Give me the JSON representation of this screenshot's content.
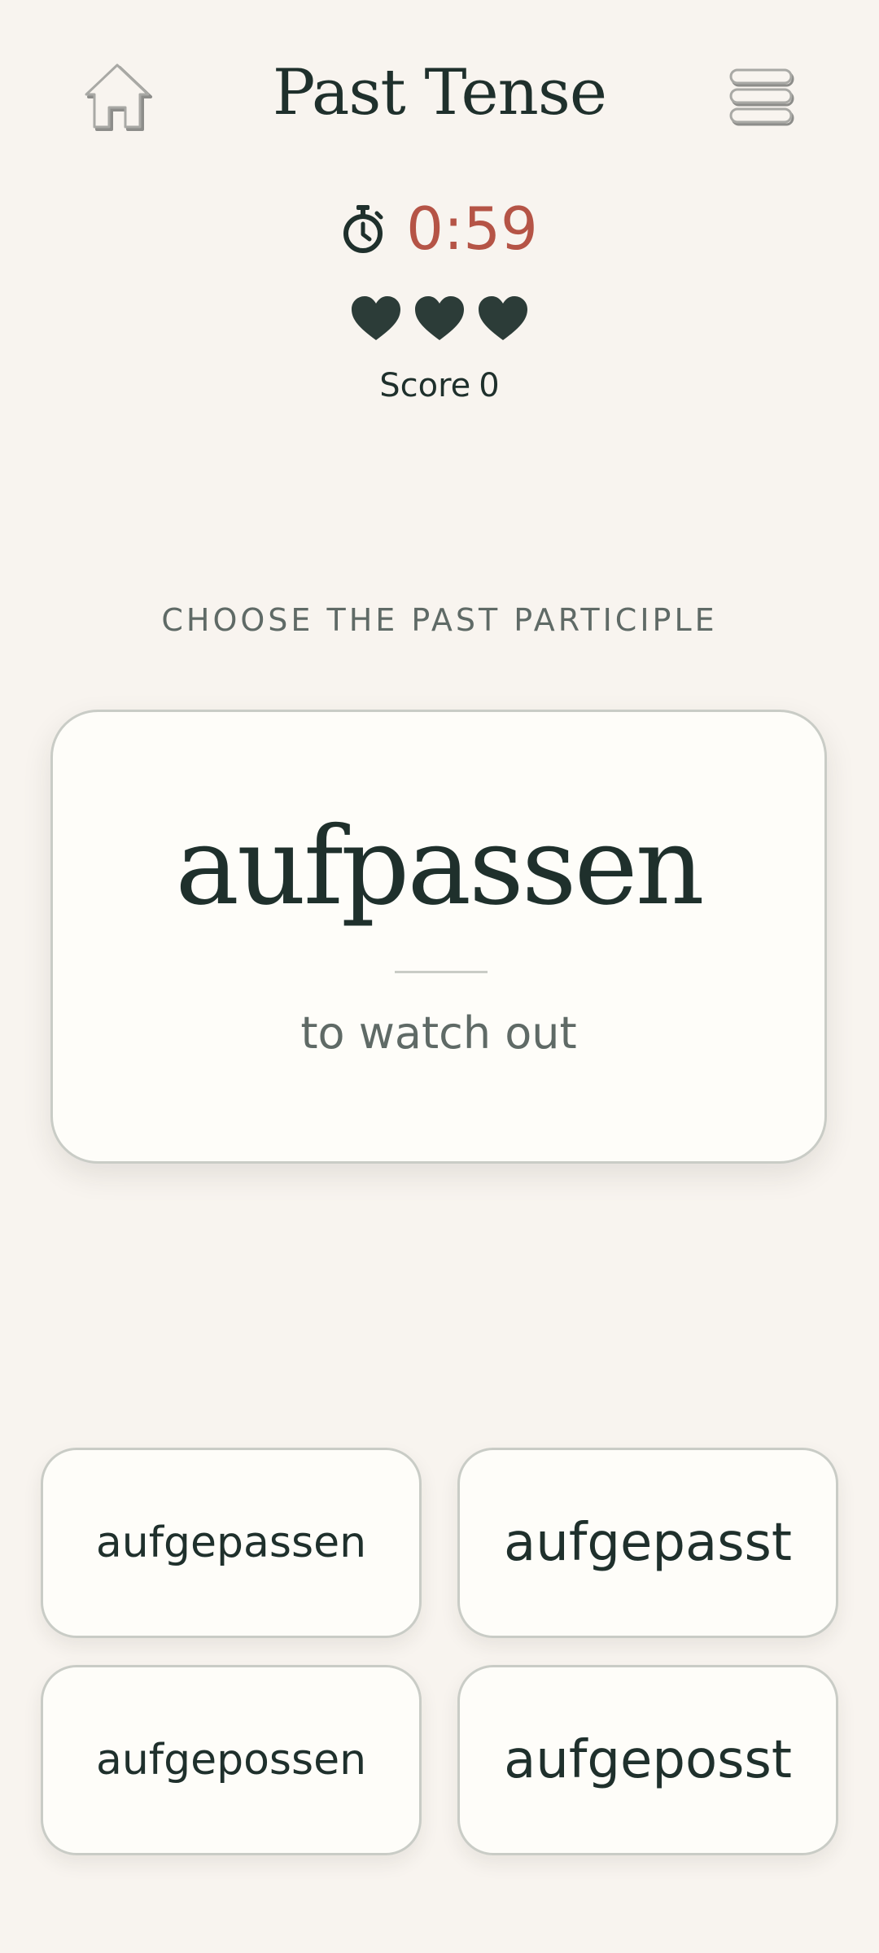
{
  "header": {
    "title": "Past Tense",
    "home_icon": "home-icon",
    "menu_icon": "hamburger-menu-icon"
  },
  "status": {
    "timer": "0:59",
    "timer_icon": "stopwatch-icon",
    "timer_color": "#b55446",
    "lives": 3,
    "heart_icon": "heart-icon",
    "score_label": "Score",
    "score_value": "0"
  },
  "question": {
    "instruction": "CHOOSE THE PAST PARTICIPLE",
    "verb": "aufpassen",
    "translation": "to watch out"
  },
  "options": [
    {
      "label": "aufgepassen"
    },
    {
      "label": "aufgepasst"
    },
    {
      "label": "aufgepossen"
    },
    {
      "label": "aufgeposst"
    }
  ],
  "colors": {
    "background": "#f8f4ef",
    "card": "#fefdf9",
    "text": "#1f302c",
    "muted": "#5f6a66",
    "border": "#c9ccc6"
  }
}
